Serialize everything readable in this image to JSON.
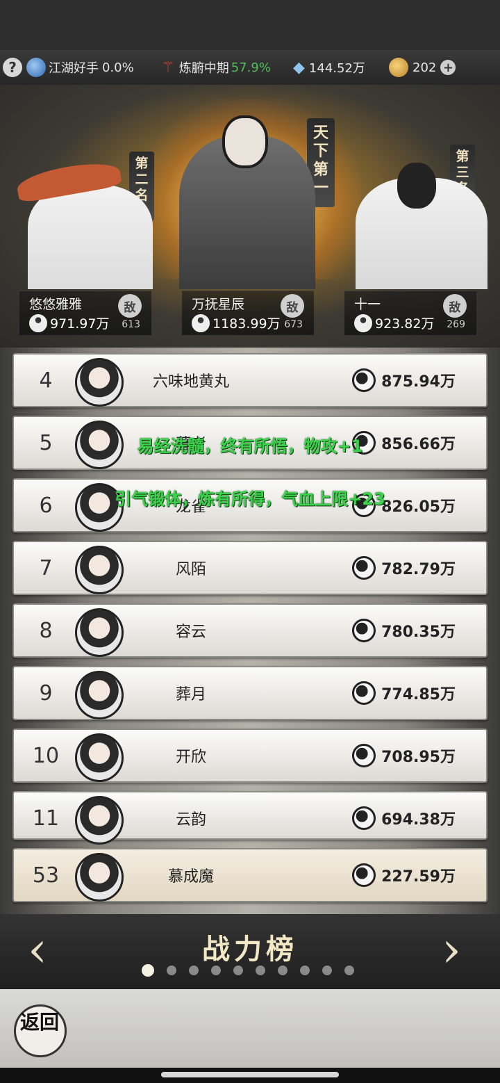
{
  "topbar": {
    "help": "?",
    "rank_title": "江湖好手",
    "rank_pct": "0.0%",
    "realm": "炼腑中期",
    "realm_pct": "57.9%",
    "crystals": "144.52万",
    "currency": "202",
    "add": "+"
  },
  "podium": {
    "second": {
      "banner": "第二名",
      "name": "悠悠雅雅",
      "power": "971.97万",
      "seal": "敌",
      "seal_num": "613"
    },
    "first": {
      "banner": "天下第一",
      "name": "万抚星辰",
      "power": "1183.99万",
      "seal": "敌",
      "seal_num": "673"
    },
    "third": {
      "banner": "第三名",
      "name": "十一",
      "power": "923.82万",
      "seal": "敌",
      "seal_num": "269"
    }
  },
  "rows": [
    {
      "rank": "4",
      "name": "六味地黄丸",
      "power": "875.94万"
    },
    {
      "rank": "5",
      "name": "暮者",
      "power": "856.66万"
    },
    {
      "rank": "6",
      "name": "龙雀",
      "power": "826.05万"
    },
    {
      "rank": "7",
      "name": "风陌",
      "power": "782.79万"
    },
    {
      "rank": "8",
      "name": "容云",
      "power": "780.35万"
    },
    {
      "rank": "9",
      "name": "葬月",
      "power": "774.85万"
    },
    {
      "rank": "10",
      "name": "开欣",
      "power": "708.95万"
    },
    {
      "rank": "11",
      "name": "云韵",
      "power": "694.38万"
    }
  ],
  "me": {
    "rank": "53",
    "name": "慕成魔",
    "power": "227.59万"
  },
  "toasts": [
    "易经洗髓，终有所悟，物攻+1",
    "引气锻体，炼有所得，气血上限+23"
  ],
  "pager": {
    "title": "战力榜",
    "prev": "‹",
    "next": "›",
    "page_count": 10,
    "active_index": 0
  },
  "footer": {
    "back_label": "返回"
  }
}
